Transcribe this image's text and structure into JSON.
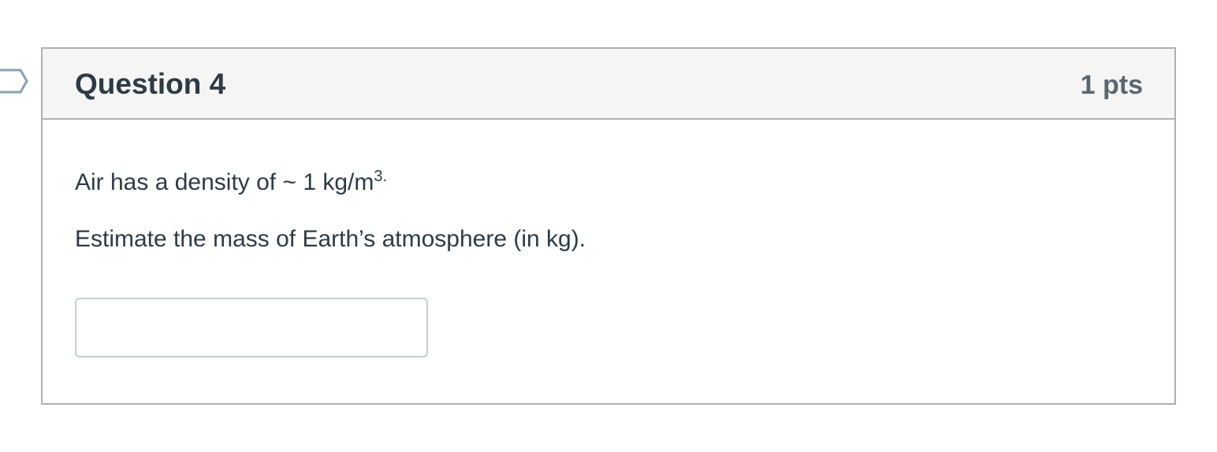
{
  "question": {
    "title": "Question 4",
    "points": "1 pts",
    "prompt_line_1_text": "Air has a density of ~ 1 kg/m",
    "prompt_line_1_superscript": "3.",
    "prompt_line_2": "Estimate the mass of Earth’s atmosphere (in kg).",
    "answer_value": "",
    "answer_placeholder": ""
  },
  "icons": {
    "flag_marker": "question-flag-icon"
  },
  "colors": {
    "header_background": "#f5f5f5",
    "border": "#b0b0b0",
    "text": "#2d3b45",
    "points_text": "#5b6770",
    "flag_outline": "#8aa0b3"
  }
}
